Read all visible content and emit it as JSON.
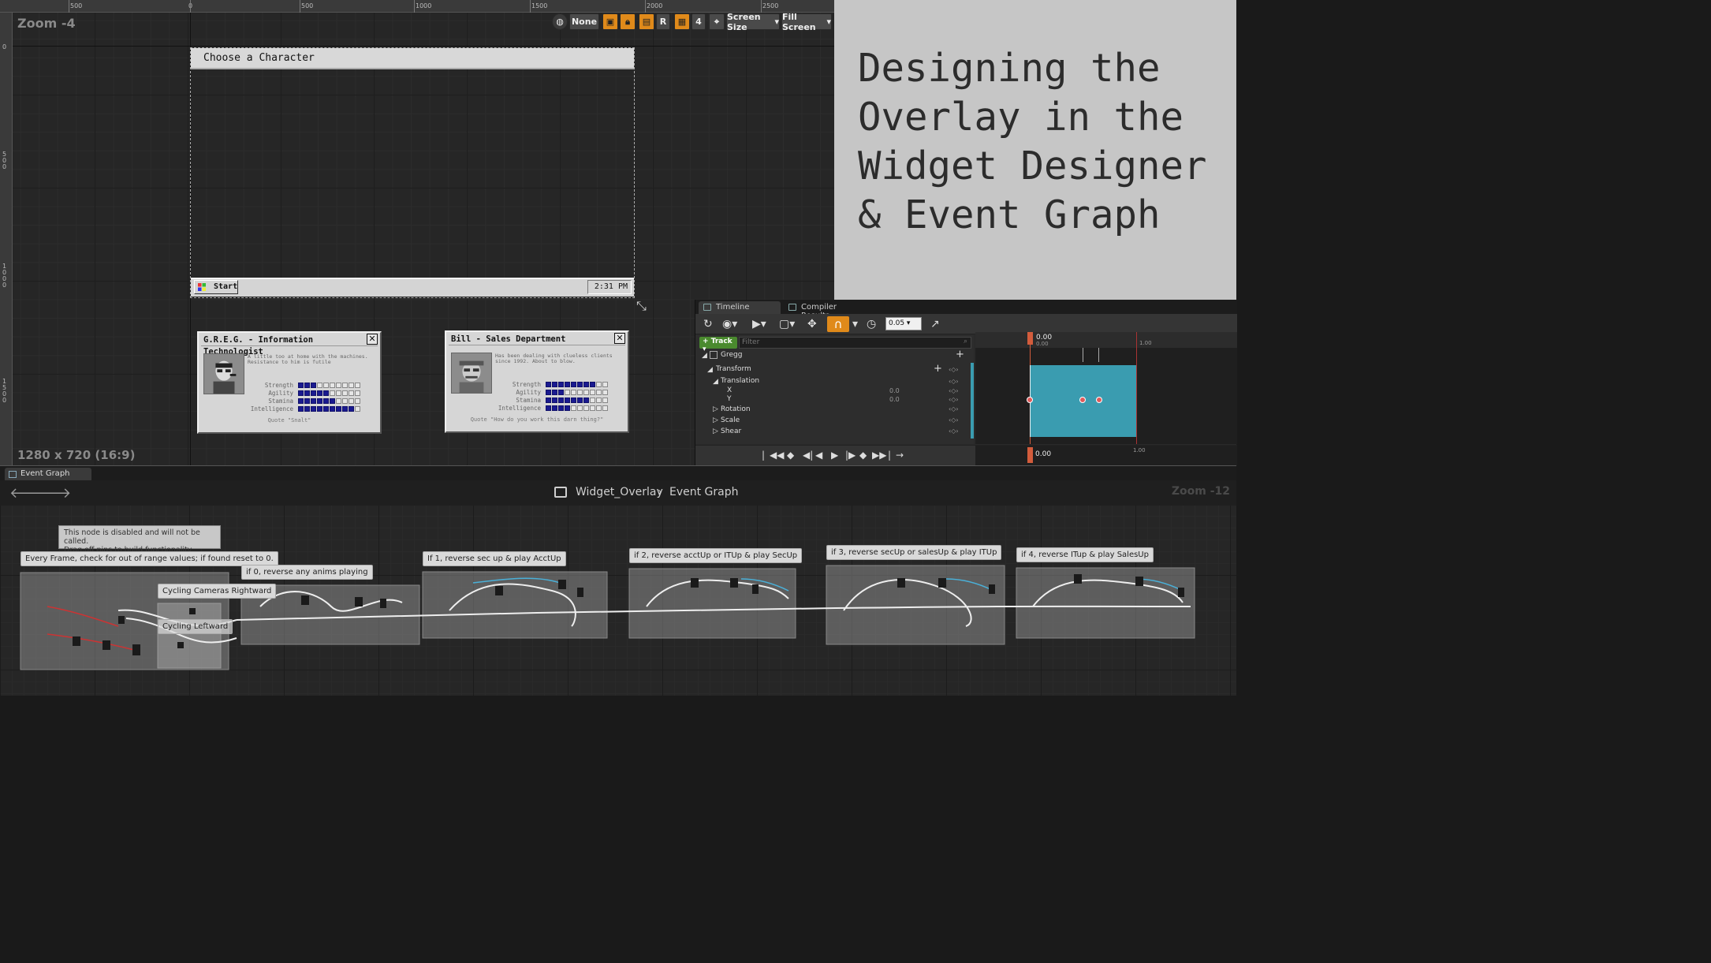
{
  "designer": {
    "zoom_label": "Zoom -4",
    "resolution_label": "1280 x 720 (16:9)",
    "ruler_top": [
      "500",
      "0",
      "500",
      "1000",
      "1500",
      "2000",
      "2500"
    ],
    "ruler_left": [
      "0",
      "500",
      "1000",
      "1500"
    ],
    "toolbar": {
      "none_label": "None",
      "r_label": "R",
      "grid_count": "4",
      "screen_size_label": "Screen Size",
      "fill_screen_label": "Fill Screen"
    },
    "window_title": "Choose a Character",
    "start_label": "Start",
    "clock": "2:31 PM",
    "cards": [
      {
        "title": "G.R.E.G. - Information Technologist",
        "description": "A little too at home with the machines. Resistance to him is futile",
        "stats": [
          {
            "label": "Strength",
            "value": 3
          },
          {
            "label": "Agility",
            "value": 5
          },
          {
            "label": "Stamina",
            "value": 6
          },
          {
            "label": "Intelligence",
            "value": 9
          }
        ],
        "quote": "Quote \"Snalt\""
      },
      {
        "title": "Bill - Sales Department",
        "description": "Has been dealing with clueless clients since 1992. About to blow.",
        "stats": [
          {
            "label": "Strength",
            "value": 8
          },
          {
            "label": "Agility",
            "value": 3
          },
          {
            "label": "Stamina",
            "value": 7
          },
          {
            "label": "Intelligence",
            "value": 4
          }
        ],
        "quote": "Quote \"How do you work this darn thing?\""
      }
    ]
  },
  "title_panel": {
    "text": "Designing the\nOverlay in the\nWidget Designer\n& Event Graph"
  },
  "timeline": {
    "tabs": [
      "Timeline",
      "Compiler Results"
    ],
    "step_value": "0.05",
    "track_button": "Track",
    "filter_placeholder": "Filter",
    "object_name": "Gregg",
    "tracks": {
      "transform": "Transform",
      "translation": "Translation",
      "x_label": "X",
      "y_label": "Y",
      "x_value": "0.0",
      "y_value": "0.0",
      "rotation": "Rotation",
      "scale": "Scale",
      "shear": "Shear"
    },
    "time_start": "0.00",
    "time_start_sub": "0.00",
    "time_end": "1.00",
    "bottom_time": "0.00",
    "bottom_end": "1.00"
  },
  "event_graph": {
    "tab_label": "Event Graph",
    "breadcrumb_widget": "Widget_Overlay",
    "breadcrumb_sep": "›",
    "breadcrumb_graph": "Event Graph",
    "zoom_label": "Zoom -12",
    "disabled_note": "This node is disabled and will not be called.\nDrag off pins to build functionality.",
    "comments": [
      "Every Frame, check for out of range values; if found reset to 0.",
      "Cycling Cameras Rightward",
      "Cycling Leftward",
      "if 0, reverse any anims playing",
      "If 1, reverse sec up & play AcctUp",
      "if 2, reverse acctUp or ITUp & play SecUp",
      "if 3, reverse secUp or salesUp & play ITUp",
      "if 4, reverse ITup & play SalesUp"
    ]
  },
  "colors": {
    "accent_orange": "#e08a1a",
    "key_region": "#3a9cb0",
    "stat_pip": "#1a1a90",
    "keyframe": "#e05a5a",
    "track_green": "#4a8a2e"
  }
}
